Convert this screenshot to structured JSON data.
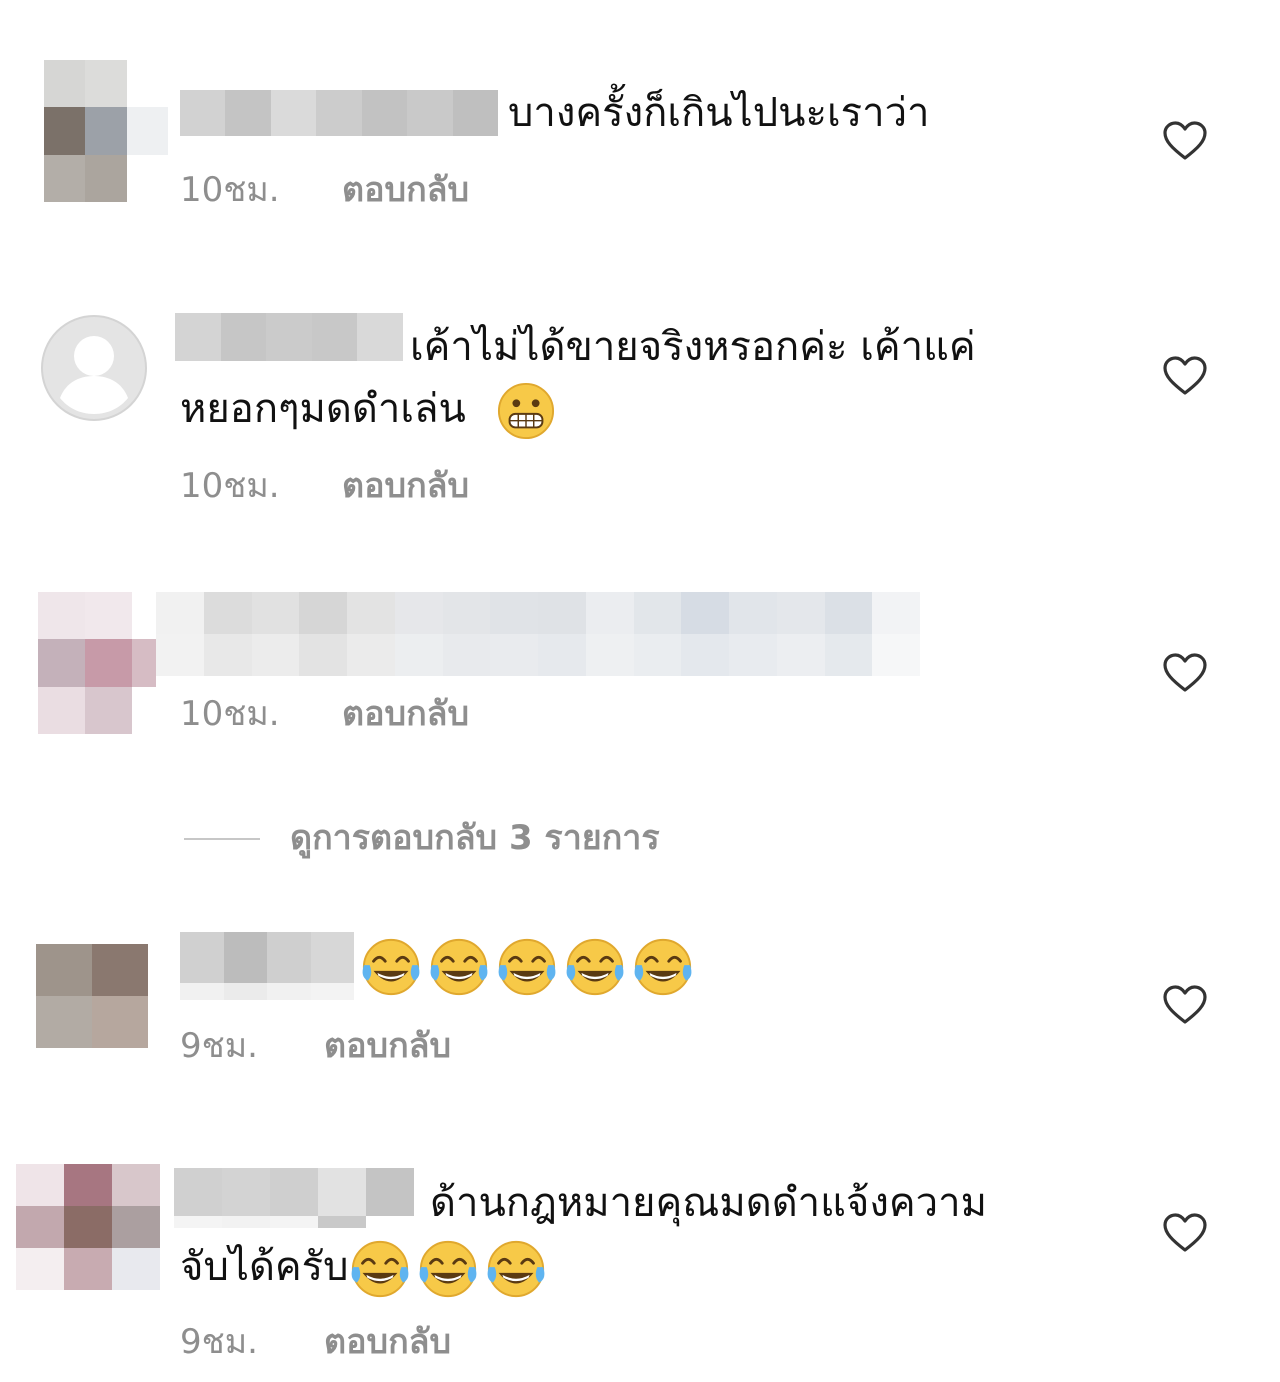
{
  "comments": [
    {
      "text_line1": "บางครั้งก็เกินไปนะเราว่า",
      "time": "10ชม.",
      "reply_label": "ตอบกลับ"
    },
    {
      "text_line1": "เค้าไม่ได้ขายจริงหรอกค่ะ เค้าแค่",
      "text_line2": "หยอกๆมดดำเล่น",
      "emoji_icon": "grimacing-face-icon",
      "time": "10ชม.",
      "reply_label": "ตอบกลับ"
    },
    {
      "time": "10ชม.",
      "reply_label": "ตอบกลับ",
      "view_replies_label": "ดูการตอบกลับ 3 รายการ"
    },
    {
      "emoji_icon": "face-with-tears-of-joy-icon",
      "emoji_count": 5,
      "time": "9ชม.",
      "reply_label": "ตอบกลับ"
    },
    {
      "text_line1": "ด้านกฎหมายคุณมดดำแจ้งความ",
      "text_line2": "จับได้ครับ",
      "emoji_icon": "face-with-tears-of-joy-icon",
      "emoji_count": 3,
      "time": "9ชม.",
      "reply_label": "ตอบกลับ"
    }
  ],
  "icons": {
    "like": "heart-outline-icon",
    "default_avatar": "default-avatar-icon"
  },
  "colors": {
    "meta_text": "#8e8e8e",
    "divider": "#c7c7c7",
    "emoji_yellow": "#f7c948"
  }
}
